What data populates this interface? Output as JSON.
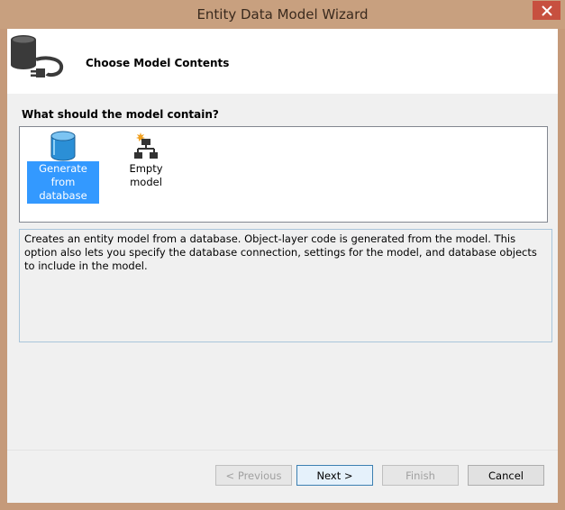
{
  "window": {
    "title": "Entity Data Model Wizard"
  },
  "banner": {
    "title": "Choose Model Contents",
    "icon": "database-plug-icon"
  },
  "section": {
    "label": "What should the model contain?"
  },
  "model_options": [
    {
      "label": "Generate from database",
      "icon": "database-icon",
      "selected": true
    },
    {
      "label": "Empty model",
      "icon": "empty-model-icon",
      "selected": false
    }
  ],
  "description": "Creates an entity model from a database. Object-layer code is generated from the model. This option also lets you specify the database connection, settings for the model, and database objects to include in the model.",
  "buttons": {
    "previous": "< Previous",
    "next": "Next >",
    "finish": "Finish",
    "cancel": "Cancel"
  },
  "colors": {
    "title_bar": "#c8a07f",
    "close_button": "#c7503f",
    "selection": "#3399ff",
    "database_blue": "#2b8fd6"
  }
}
